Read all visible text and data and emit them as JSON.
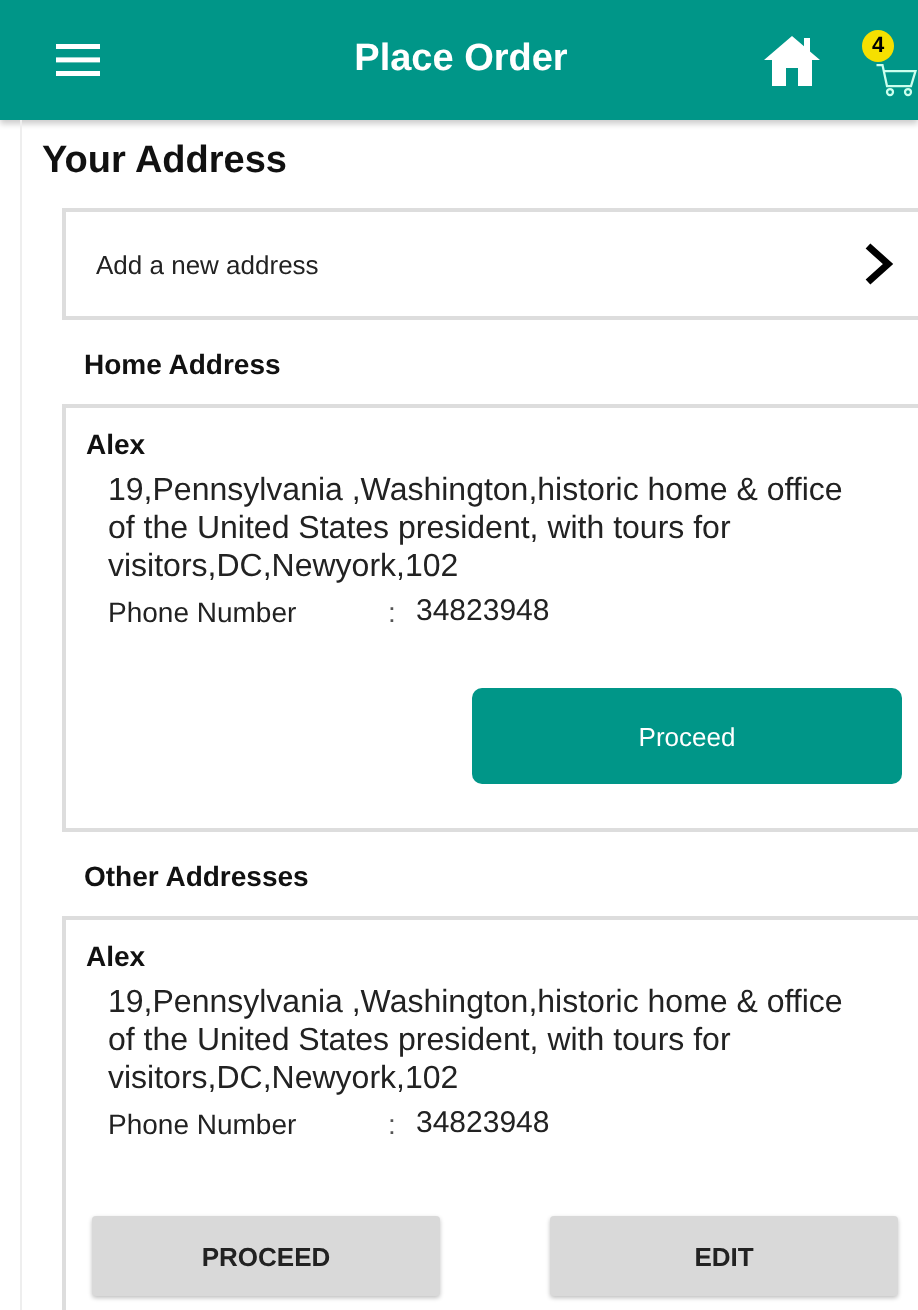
{
  "header": {
    "title": "Place Order",
    "cart_count": "4"
  },
  "heading": "Your Address",
  "add_address": {
    "label": "Add a new address"
  },
  "sections": [
    {
      "title": "Home Address",
      "card": {
        "name": "Alex",
        "address": "19,Pennsylvania ,Washington,historic home & office of the United States president, with tours for visitors,DC,Newyork,102",
        "phone_label": "Phone Number",
        "separator": ":",
        "phone": "34823948",
        "buttons": [
          {
            "kind": "primary",
            "label": "Proceed"
          }
        ]
      }
    },
    {
      "title": "Other Addresses",
      "card": {
        "name": "Alex",
        "address": "19,Pennsylvania ,Washington,historic home & office of the United States president, with tours for visitors,DC,Newyork,102",
        "phone_label": "Phone Number",
        "separator": ":",
        "phone": "34823948",
        "buttons": [
          {
            "kind": "secondary",
            "label": "PROCEED"
          },
          {
            "kind": "secondary",
            "label": "EDIT"
          }
        ]
      }
    }
  ]
}
